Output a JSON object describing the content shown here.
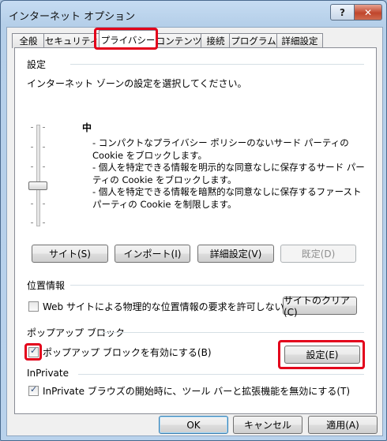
{
  "window": {
    "title": "インターネット オプション",
    "help_label": "?",
    "close_label": "✕"
  },
  "tabs": [
    {
      "label": "全般"
    },
    {
      "label": "セキュリティ"
    },
    {
      "label": "プライバシー"
    },
    {
      "label": "コンテンツ"
    },
    {
      "label": "接続"
    },
    {
      "label": "プログラム"
    },
    {
      "label": "詳細設定"
    }
  ],
  "settings": {
    "header": "設定",
    "instruction": "インターネット ゾーンの設定を選択してください。",
    "level": "中",
    "slider_level": 0.5,
    "description": [
      "- コンパクトなプライバシー ポリシーのないサード パーティの Cookie をブロックします。",
      "- 個人を特定できる情報を明示的な同意なしに保存するサード パーティの Cookie をブロックします。",
      "- 個人を特定できる情報を暗黙的な同意なしに保存するファースト パーティの Cookie を制限します。"
    ],
    "buttons": {
      "sites": "サイト(S)",
      "import": "インポート(I)",
      "advanced": "詳細設定(V)",
      "default": "既定(D)"
    }
  },
  "location": {
    "header": "位置情報",
    "checkbox_label": "Web サイトによる物理的な位置情報の要求を許可しない(L)",
    "checked": false,
    "clear_button": "サイトのクリア(C)"
  },
  "popup": {
    "header": "ポップアップ ブロック",
    "checkbox_label": "ポップアップ ブロックを有効にする(B)",
    "checked": true,
    "settings_button": "設定(E)"
  },
  "inprivate": {
    "header": "InPrivate",
    "checkbox_label": "InPrivate ブラウズの開始時に、ツール バーと拡張機能を無効にする(T)",
    "checked": true
  },
  "footer": {
    "ok": "OK",
    "cancel": "キャンセル",
    "apply": "適用(A)"
  },
  "colors": {
    "highlight": "#e3001b",
    "window_frame": "#b9d2ec",
    "close_button": "#c0462c"
  }
}
